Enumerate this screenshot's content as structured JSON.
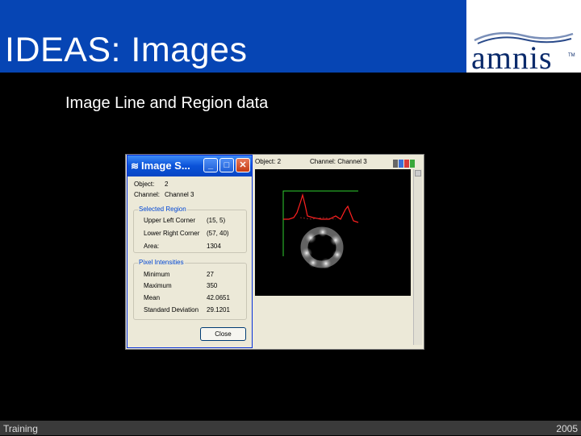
{
  "slide": {
    "title": "IDEAS: Images",
    "subtitle": "Image Line and Region data",
    "logo": "amnis",
    "logo_tm": "TM",
    "footer_left": "Training",
    "footer_right": "2005"
  },
  "viewer": {
    "object_label": "Object: 2",
    "channel_label": "Channel: Channel 3",
    "toolbar_icons": [
      "grid-icon",
      "blue-channel-icon",
      "red-channel-icon",
      "green-channel-icon"
    ]
  },
  "dialog": {
    "title": "Image S...",
    "title_icon": "≋",
    "object_label": "Object:",
    "object_value": "2",
    "channel_label": "Channel:",
    "channel_value": "Channel 3",
    "selected_region": {
      "legend": "Selected Region",
      "rows": [
        {
          "label": "Upper Left Corner",
          "value": "(15, 5)"
        },
        {
          "label": "Lower Right Corner",
          "value": "(57, 40)"
        },
        {
          "label": "Area:",
          "value": "1304"
        }
      ]
    },
    "pixel_intensities": {
      "legend": "Pixel Intensities",
      "rows": [
        {
          "label": "Minimum",
          "value": "27"
        },
        {
          "label": "Maximum",
          "value": "350"
        },
        {
          "label": "Mean",
          "value": "42.0651"
        },
        {
          "label": "Standard Deviation",
          "value": "29.1201"
        }
      ]
    },
    "close_label": "Close"
  },
  "colors": {
    "title_bar": "#0645b4",
    "intensity_line": "#ff2020",
    "region_box": "#30d030"
  }
}
